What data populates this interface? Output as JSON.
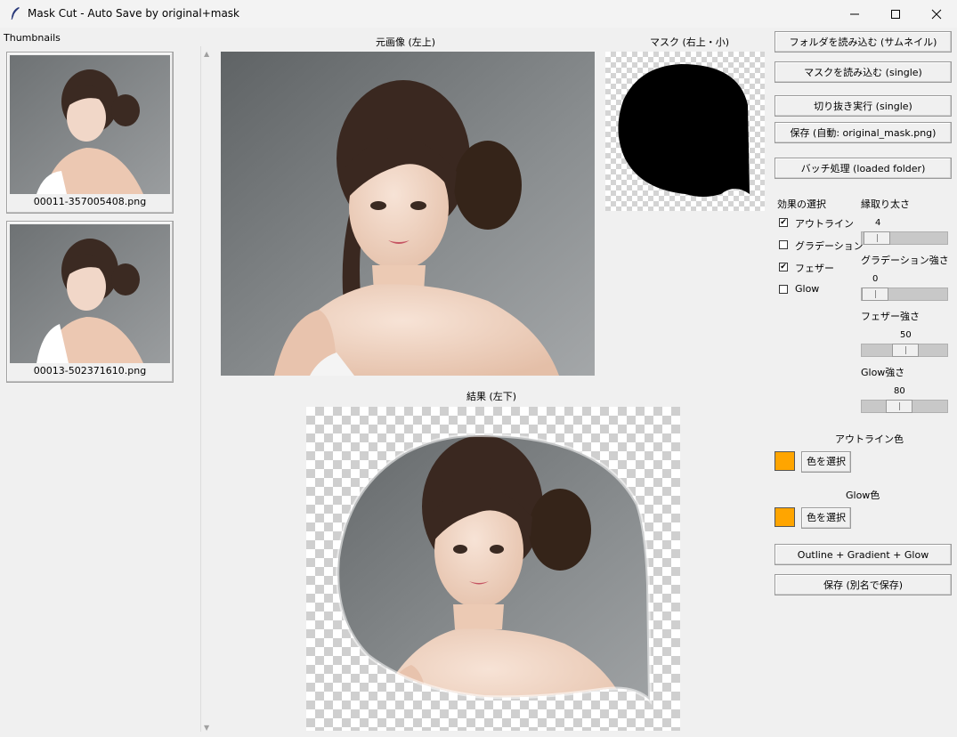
{
  "window": {
    "title": "Mask Cut - Auto Save by original+mask",
    "minimize_icon": "minimize-icon",
    "maximize_icon": "maximize-icon",
    "close_icon": "close-icon"
  },
  "sidebar": {
    "heading": "Thumbnails",
    "thumbnails": [
      {
        "filename": "00011-357005408.png",
        "image": "portrait-photo"
      },
      {
        "filename": "00013-502371610.png",
        "image": "portrait-photo"
      }
    ]
  },
  "canvas": {
    "original_label": "元画像 (左上)",
    "mask_label": "マスク (右上・小)",
    "result_label": "結果 (左下)"
  },
  "controls": {
    "load_folder_button": "フォルダを読み込む (サムネイル)",
    "load_mask_button": "マスクを読み込む (single)",
    "cut_button": "切り抜き実行 (single)",
    "save_auto_button": "保存 (自動: original_mask.png)",
    "batch_button": "バッチ処理 (loaded folder)",
    "effects_heading": "効果の選択",
    "effects": [
      {
        "label": "アウトライン",
        "checked": true,
        "mark": "✔"
      },
      {
        "label": "グラデーション",
        "checked": false,
        "mark": ""
      },
      {
        "label": "フェザー",
        "checked": true,
        "mark": "✔"
      },
      {
        "label": "Glow",
        "checked": false,
        "mark": ""
      }
    ],
    "sliders": [
      {
        "label": "縁取り太さ",
        "value": "4",
        "fraction": 0.1
      },
      {
        "label": "グラデーション強さ",
        "value": "0",
        "fraction": 0.0
      },
      {
        "label": "フェザー強さ",
        "value": "50",
        "fraction": 0.5
      },
      {
        "label": "Glow強さ",
        "value": "80",
        "fraction": 0.45
      }
    ],
    "outline_color_label": "アウトライン色",
    "outline_color": "#ffa500",
    "outline_color_button": "色を選択",
    "glow_color_label": "Glow色",
    "glow_color": "#ffa500",
    "glow_color_button": "色を選択",
    "combo_button": "Outline + Gradient + Glow",
    "save_as_button": "保存 (別名で保存)"
  }
}
